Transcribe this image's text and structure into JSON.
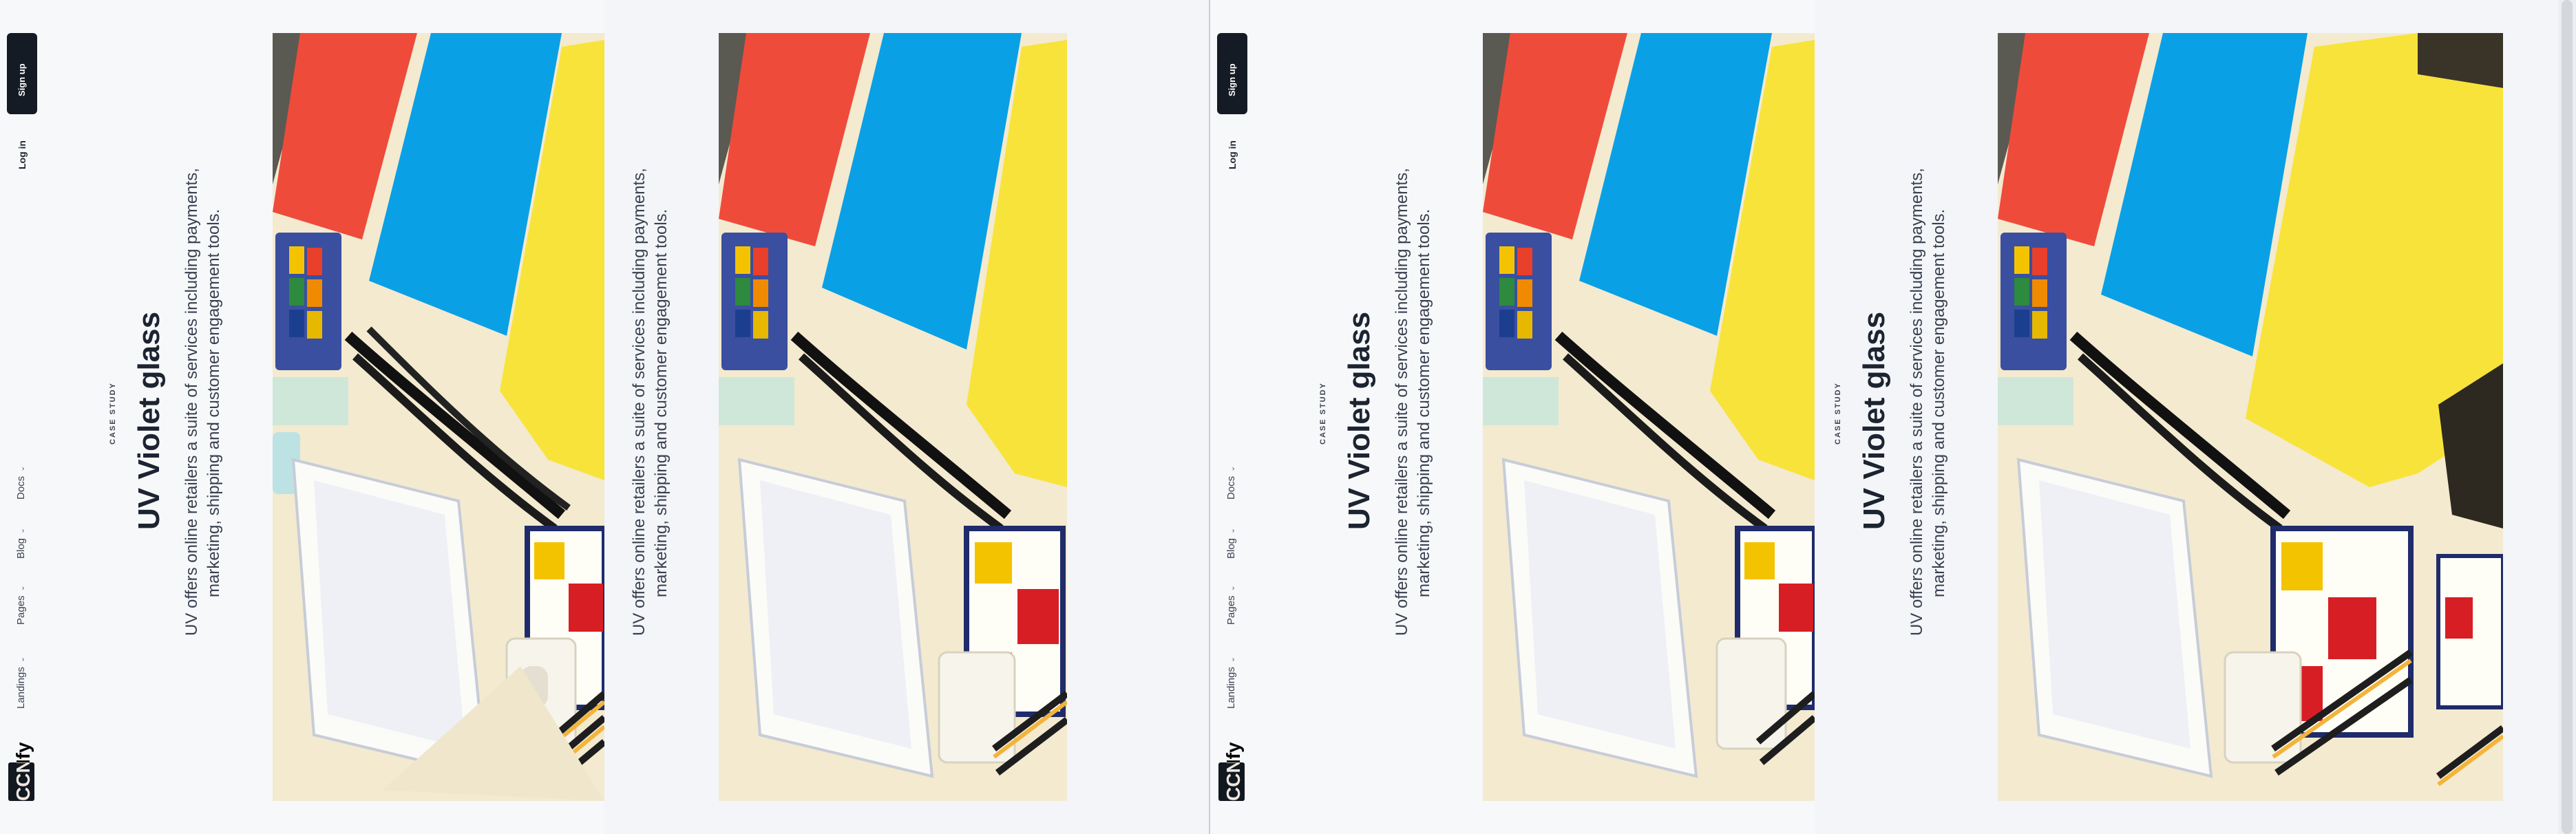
{
  "brand": {
    "logo_text": "CCNfy"
  },
  "nav": {
    "items": [
      {
        "label": "Landings"
      },
      {
        "label": "Pages"
      },
      {
        "label": "Blog"
      },
      {
        "label": "Docs"
      }
    ],
    "chevron": "chevron-down-icon"
  },
  "auth": {
    "login_label": "Log in",
    "signup_label": "Sign up"
  },
  "hero": {
    "eyebrow": "CASE STUDY",
    "title": "UV Violet glass",
    "description_line_1": "UV offers online retailers a suite of services including payments,",
    "description_line_2": "marketing, shipping and customer engagement tools."
  },
  "colors": {
    "background": "#f7f8fa",
    "text": "#1d2431",
    "button": "#151b24",
    "paper_red": "#ef4b3b",
    "paper_blue": "#0aa0e6",
    "paper_yellow": "#f8e33a"
  }
}
